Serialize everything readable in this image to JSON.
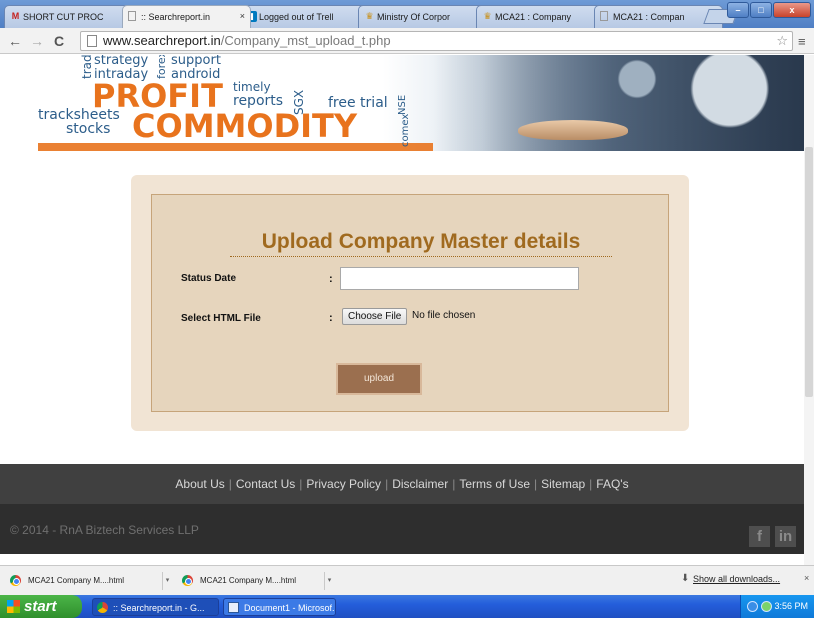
{
  "browser": {
    "tabs": [
      {
        "icon": "gmail-icon",
        "title": "SHORT CUT PROC",
        "active": false
      },
      {
        "icon": "page-icon",
        "title": ":: Searchreport.in",
        "active": true
      },
      {
        "icon": "trello-icon",
        "title": "Logged out of Trell",
        "active": false
      },
      {
        "icon": "emblem-icon",
        "title": "Ministry Of Corpor",
        "active": false
      },
      {
        "icon": "emblem-icon",
        "title": "MCA21 : Company",
        "active": false
      },
      {
        "icon": "page-icon",
        "title": "MCA21 : Compan",
        "active": false
      }
    ],
    "tab_close_glyph": "×",
    "window_controls": [
      "–",
      "□",
      "x"
    ],
    "url_host": "www.searchreport.in",
    "url_path": "/Company_mst_upload_t.php"
  },
  "banner": {
    "words": {
      "trading": "trading",
      "strategy": "strategy",
      "forex": "forex",
      "support": "support",
      "intraday": "intraday",
      "android": "android",
      "profit": "PROFIT",
      "timely": "timely",
      "reports": "reports",
      "sgx": "SGX",
      "free_trial": "free trial",
      "nse": "NSE",
      "tracksheets": "tracksheets",
      "stocks": "stocks",
      "commodity": "COMMODITY",
      "comex": "comex"
    }
  },
  "form": {
    "title": "Upload Company Master details",
    "status_date_label": "Status Date",
    "status_date_value": "",
    "colon": ":",
    "select_file_label": "Select HTML File",
    "choose_file_button": "Choose File",
    "no_file_text": "No file chosen",
    "upload_button": "upload"
  },
  "footer": {
    "links": [
      "About Us",
      "Contact Us",
      "Privacy Policy",
      "Disclaimer",
      "Terms of Use",
      "Sitemap",
      "FAQ's"
    ],
    "separator": "|",
    "copyright": "© 2014 - RnA Biztech Services LLP",
    "social": [
      "f",
      "in"
    ]
  },
  "downloads": {
    "items": [
      {
        "name": "MCA21  Company M....html"
      },
      {
        "name": "MCA21  Company M....html"
      }
    ],
    "menu_arrow": "▾",
    "show_all": "Show all downloads...",
    "show_all_icon": "⬇",
    "close": "×"
  },
  "taskbar": {
    "start_label": "start",
    "buttons": [
      {
        "label": ":: Searchreport.in - G...",
        "icon": "chrome-icon"
      },
      {
        "label": "Document1 - Microsof...",
        "icon": "word-icon"
      }
    ],
    "clock": "3:56 PM"
  },
  "colors": {
    "panel_outer": "#f1e4d4",
    "panel_inner": "#e6d5bd",
    "title": "#a06a1f",
    "upload_button": "#9b6f4f",
    "footer_top": "#404040",
    "footer_bottom": "#2e2e2e"
  }
}
